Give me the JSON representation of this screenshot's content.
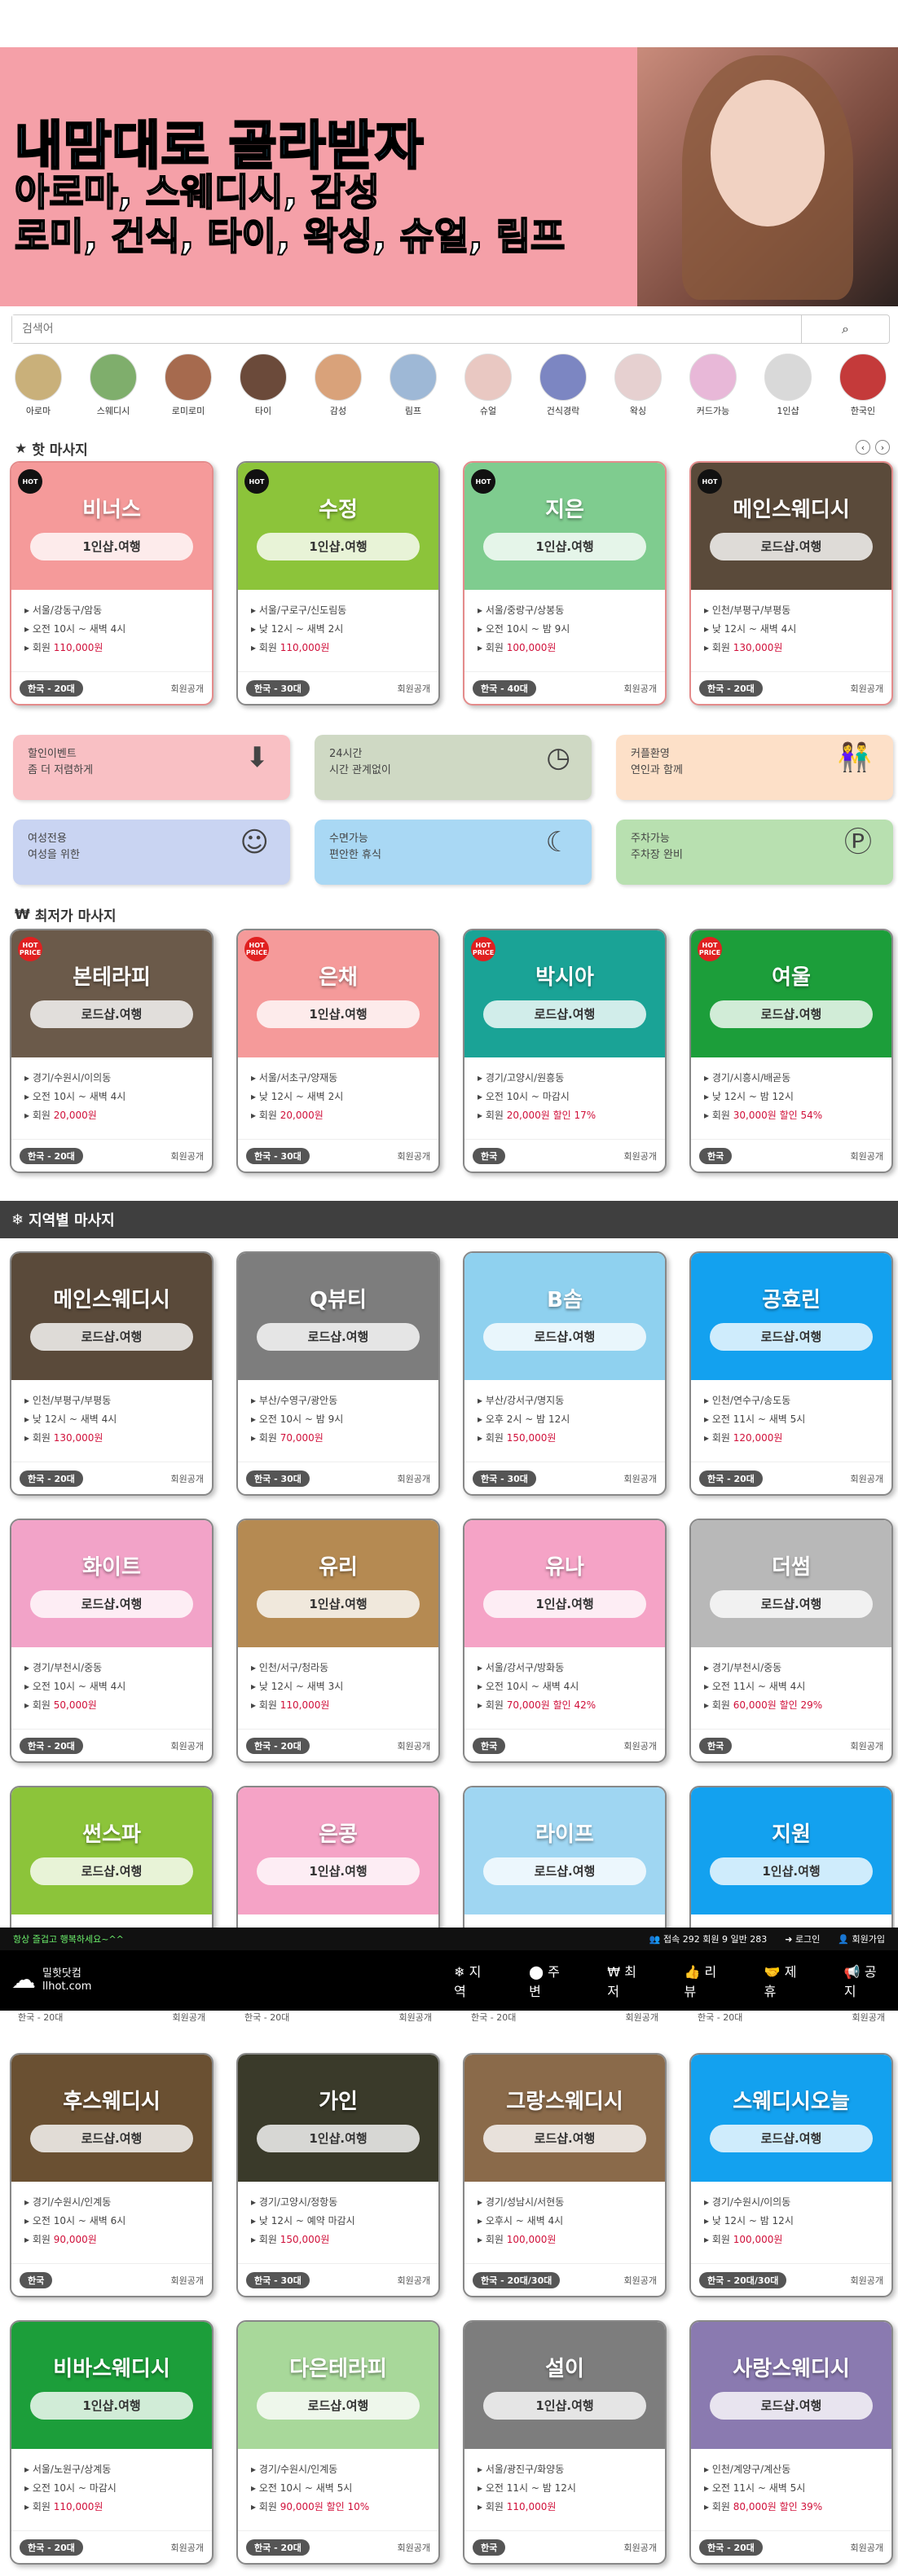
{
  "banner": {
    "line1": "내맘대로 골라받자",
    "line2": "아로마, 스웨디시, 감성",
    "line3": "로미, 건식, 타이, 왁싱, 슈얼, 림프"
  },
  "search": {
    "placeholder": "검색어",
    "button_icon": "search-icon"
  },
  "categories": [
    {
      "label": "아로마",
      "color": "#c9b07a"
    },
    {
      "label": "스웨디시",
      "color": "#7fae6c"
    },
    {
      "label": "로미로미",
      "color": "#a66a4e"
    },
    {
      "label": "타이",
      "color": "#6b4a3a"
    },
    {
      "label": "감성",
      "color": "#d9a27a"
    },
    {
      "label": "림프",
      "color": "#9eb8d6"
    },
    {
      "label": "슈얼",
      "color": "#e9c8c2"
    },
    {
      "label": "건식경락",
      "color": "#7c86c2"
    },
    {
      "label": "왁싱",
      "color": "#e6d0d0"
    },
    {
      "label": "커드가능",
      "color": "#e8b8d8"
    },
    {
      "label": "1인샵",
      "color": "#d9d9d9"
    },
    {
      "label": "한국인",
      "color": "#c43a3a"
    }
  ],
  "hot_title": "핫 마사지",
  "hot": [
    {
      "name": "비너스",
      "tag": "1인샵.여행",
      "color": "#f59a9a",
      "border": "pink",
      "badge": "HOT",
      "addr": "서울/강동구/암동",
      "hours": "오전 10시 ~ 새벽 4시",
      "price": "110,000원",
      "disc": "",
      "age": "한국 - 20대",
      "foot": "회원공개"
    },
    {
      "name": "수정",
      "tag": "1인샵.여행",
      "color": "#8cc43a",
      "border": "gray",
      "badge": "HOT",
      "addr": "서울/구로구/신도림동",
      "hours": "낮 12시 ~ 새벽 2시",
      "price": "110,000원",
      "disc": "",
      "age": "한국 - 30대",
      "foot": "회원공개"
    },
    {
      "name": "지은",
      "tag": "1인샵.여행",
      "color": "#7fcc8f",
      "border": "pink",
      "badge": "HOT",
      "addr": "서울/중랑구/상봉동",
      "hours": "오전 10시 ~ 밤 9시",
      "price": "100,000원",
      "disc": "",
      "age": "한국 - 40대",
      "foot": "회원공개"
    },
    {
      "name": "메인스웨디시",
      "tag": "로드샵.여행",
      "color": "#5a4a3a",
      "border": "pink",
      "badge": "HOT",
      "addr": "인천/부평구/부평동",
      "hours": "낮 12시 ~ 새벽 4시",
      "price": "130,000원",
      "disc": "",
      "age": "한국 - 20대",
      "foot": "회원공개"
    }
  ],
  "promos": [
    {
      "l1": "할인이벤트",
      "l2": "좀 더 저렴하게",
      "color": "#f9c0c4",
      "icon": "down-arrow-icon",
      "glyph": "⬇"
    },
    {
      "l1": "24시간",
      "l2": "시간 관계없이",
      "color": "#cfd9c4",
      "icon": "clock-icon",
      "glyph": "◷"
    },
    {
      "l1": "커플환영",
      "l2": "연인과 함께",
      "color": "#fde0c8",
      "icon": "couple-icon",
      "glyph": "👫"
    },
    {
      "l1": "여성전용",
      "l2": "여성을 위한",
      "color": "#c9d4f2",
      "icon": "woman-icon",
      "glyph": "☺"
    },
    {
      "l1": "수면가능",
      "l2": "편안한 휴식",
      "color": "#a9d8f4",
      "icon": "sleep-icon",
      "glyph": "☾"
    },
    {
      "l1": "주차가능",
      "l2": "주차장 완비",
      "color": "#b8e0b0",
      "icon": "parking-icon",
      "glyph": "Ⓟ"
    }
  ],
  "cheap_title": "최저가 마사지",
  "cheap": [
    {
      "name": "본테라피",
      "tag": "로드샵.여행",
      "color": "#6b5a4a",
      "border": "gray",
      "badge": "HOT PRICE",
      "addr": "경기/수원시/이의동",
      "hours": "오전 10시 ~ 새벽 4시",
      "price": "20,000원",
      "disc": "",
      "age": "한국 - 20대",
      "foot": "회원공개"
    },
    {
      "name": "은채",
      "tag": "1인샵.여행",
      "color": "#f59a9a",
      "border": "gray",
      "badge": "HOT PRICE",
      "addr": "서울/서초구/양재동",
      "hours": "낮 12시 ~ 새벽 2시",
      "price": "20,000원",
      "disc": "",
      "age": "한국 - 30대",
      "foot": "회원공개"
    },
    {
      "name": "박시아",
      "tag": "로드샵.여행",
      "color": "#1aa396",
      "border": "gray",
      "badge": "HOT PRICE",
      "addr": "경기/고양시/원흥동",
      "hours": "오전 10시 ~ 마감시",
      "price": "20,000원",
      "disc": "할인 17%",
      "age": "한국",
      "foot": "회원공개"
    },
    {
      "name": "여울",
      "tag": "로드샵.여행",
      "color": "#1c9e3a",
      "border": "gray",
      "badge": "HOT PRICE",
      "addr": "경기/시흥시/배곧동",
      "hours": "낮 12시 ~ 밤 12시",
      "price": "30,000원",
      "disc": "할인 54%",
      "age": "한국",
      "foot": "회원공개"
    }
  ],
  "region_title": "지역별 마사지",
  "region_row1": [
    {
      "name": "메인스웨디시",
      "tag": "로드샵.여행",
      "color": "#5a4a3a",
      "addr": "인천/부평구/부평동",
      "hours": "낮 12시 ~ 새벽 4시",
      "price": "130,000원",
      "disc": "",
      "age": "한국 - 20대",
      "foot": "회원공개"
    },
    {
      "name": "Q뷰티",
      "tag": "로드샵.여행",
      "color": "#7d7d7d",
      "addr": "부산/수영구/광안동",
      "hours": "오전 10시 ~ 밤 9시",
      "price": "70,000원",
      "disc": "",
      "age": "한국 - 30대",
      "foot": "회원공개"
    },
    {
      "name": "B솜",
      "tag": "로드샵.여행",
      "color": "#8fd1ef",
      "addr": "부산/강서구/명지동",
      "hours": "오후 2시 ~ 밤 12시",
      "price": "150,000원",
      "disc": "",
      "age": "한국 - 30대",
      "foot": "회원공개"
    },
    {
      "name": "공효린",
      "tag": "로드샵.여행",
      "color": "#13a1ef",
      "addr": "인천/연수구/송도동",
      "hours": "오전 11시 ~ 새벽 5시",
      "price": "120,000원",
      "disc": "",
      "age": "한국 - 20대",
      "foot": "회원공개"
    }
  ],
  "region_row2": [
    {
      "name": "화이트",
      "tag": "로드샵.여행",
      "color": "#f2a3c8",
      "addr": "경기/부천시/중동",
      "hours": "오전 10시 ~ 새벽 4시",
      "price": "50,000원",
      "disc": "",
      "age": "한국 - 20대",
      "foot": "회원공개"
    },
    {
      "name": "유리",
      "tag": "1인샵.여행",
      "color": "#b58a52",
      "addr": "인천/서구/청라동",
      "hours": "낮 12시 ~ 새벽 3시",
      "price": "110,000원",
      "disc": "",
      "age": "한국 - 20대",
      "foot": "회원공개"
    },
    {
      "name": "유나",
      "tag": "1인샵.여행",
      "color": "#f5a3c6",
      "addr": "서울/강서구/방화동",
      "hours": "오전 10시 ~ 새벽 4시",
      "price": "70,000원",
      "disc": "할인 42%",
      "age": "한국",
      "foot": "회원공개"
    },
    {
      "name": "더썸",
      "tag": "로드샵.여행",
      "color": "#b8b8b8",
      "addr": "경기/부천시/중동",
      "hours": "오전 11시 ~ 새벽 4시",
      "price": "60,000원",
      "disc": "할인 29%",
      "age": "한국",
      "foot": "회원공개"
    }
  ],
  "region_row3": [
    {
      "name": "썬스파",
      "tag": "로드샵.여행",
      "color": "#8cc43a"
    },
    {
      "name": "은콩",
      "tag": "1인샵.여행",
      "color": "#f5a3c6"
    },
    {
      "name": "라이프",
      "tag": "로드샵.여행",
      "color": "#9fd6f2"
    },
    {
      "name": "지원",
      "tag": "1인샵.여행",
      "color": "#13a1ef"
    }
  ],
  "row3_foot": [
    "한국 - 20대",
    "한국 - 20대",
    "한국 - 20대",
    "한국 - 20대"
  ],
  "row3_foot_label": "회원공개",
  "fixedbar": {
    "left": "항상 즐겁고 행복하세요~^^",
    "stats": "접속 292 회원 9 일반 283",
    "login": "로그인",
    "join": "회원가입"
  },
  "logo": {
    "name": "밀핫닷컴",
    "domain": "llhot.com"
  },
  "menu": [
    {
      "label": "지역",
      "icon": "snowflake-icon",
      "glyph": "❄"
    },
    {
      "label": "주변",
      "icon": "pin-icon",
      "glyph": "⬤"
    },
    {
      "label": "최저",
      "icon": "won-icon",
      "glyph": "₩"
    },
    {
      "label": "리뷰",
      "icon": "thumb-icon",
      "glyph": "👍"
    },
    {
      "label": "제휴",
      "icon": "handshake-icon",
      "glyph": "🤝"
    },
    {
      "label": "공지",
      "icon": "megaphone-icon",
      "glyph": "📢"
    }
  ],
  "region_row4": [
    {
      "name": "후스웨디시",
      "tag": "로드샵.여행",
      "color": "#6a5032",
      "addr": "경기/수원시/인계동",
      "hours": "오전 10시 ~ 새벽 6시",
      "price": "90,000원",
      "disc": "",
      "age": "한국",
      "foot": "회원공개"
    },
    {
      "name": "가인",
      "tag": "1인샵.여행",
      "color": "#3a3a2a",
      "addr": "경기/고양시/정항동",
      "hours": "낮 12시 ~ 예약 마감시",
      "price": "150,000원",
      "disc": "",
      "age": "한국 - 30대",
      "foot": "회원공개"
    },
    {
      "name": "그랑스웨디시",
      "tag": "로드샵.여행",
      "color": "#8a6a4a",
      "addr": "경기/성남시/서현동",
      "hours": "오후시 ~ 새벽 4시",
      "price": "100,000원",
      "disc": "",
      "age": "한국 - 20대/30대",
      "foot": "회원공개"
    },
    {
      "name": "스웨디시오늘",
      "tag": "로드샵.여행",
      "color": "#13a1ef",
      "addr": "경기/수원시/이의동",
      "hours": "낮 12시 ~ 밤 12시",
      "price": "100,000원",
      "disc": "",
      "age": "한국 - 20대/30대",
      "foot": "회원공개"
    }
  ],
  "region_row5": [
    {
      "name": "비바스웨디시",
      "tag": "1인샵.여행",
      "color": "#1c9e3a",
      "addr": "서울/노원구/상계동",
      "hours": "오전 10시 ~ 마감시",
      "price": "110,000원",
      "disc": "",
      "age": "한국 - 20대",
      "foot": "회원공개"
    },
    {
      "name": "다은테라피",
      "tag": "로드샵.여행",
      "color": "#a8d89a",
      "addr": "경기/수원시/인계동",
      "hours": "오전 10시 ~ 새벽 5시",
      "price": "90,000원",
      "disc": "할인 10%",
      "age": "한국 - 20대",
      "foot": "회원공개"
    },
    {
      "name": "설이",
      "tag": "1인샵.여행",
      "color": "#7d7d7d",
      "addr": "서울/광진구/화양동",
      "hours": "오전 11시 ~ 밤 12시",
      "price": "110,000원",
      "disc": "",
      "age": "한국",
      "foot": "회원공개"
    },
    {
      "name": "사랑스웨디시",
      "tag": "로드샵.여행",
      "color": "#8a7ab0",
      "addr": "인천/계양구/계산동",
      "hours": "오전 11시 ~ 새벽 5시",
      "price": "80,000원",
      "disc": "할인 39%",
      "age": "한국 - 20대",
      "foot": "회원공개"
    }
  ],
  "member_label": "회원"
}
